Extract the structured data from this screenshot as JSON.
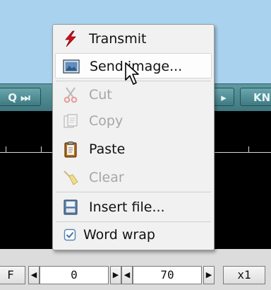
{
  "toolbar": {
    "left_button": "Q ⏭",
    "mid_button": "▸",
    "right_button": "KN"
  },
  "menu": {
    "items": [
      {
        "label": "Transmit",
        "icon": "lightning-icon",
        "enabled": true
      },
      {
        "label": "Send image...",
        "icon": "image-icon",
        "enabled": true,
        "highlighted": true
      },
      {
        "label": "Cut",
        "icon": "scissors-icon",
        "enabled": false
      },
      {
        "label": "Copy",
        "icon": "copy-icon",
        "enabled": false
      },
      {
        "label": "Paste",
        "icon": "clipboard-icon",
        "enabled": true
      },
      {
        "label": "Clear",
        "icon": "broom-icon",
        "enabled": false
      },
      {
        "label": "Insert file...",
        "icon": "file-icon",
        "enabled": true
      },
      {
        "label": "Word wrap",
        "icon": "checkbox-icon",
        "enabled": true,
        "checked": true
      }
    ]
  },
  "bottom_bar": {
    "f_label": "F",
    "left_value": "0",
    "right_value": "70",
    "zoom_label": "x1"
  },
  "colors": {
    "sky": "#a8d2ee",
    "toolbar_teal": "#4d8a91",
    "waterfall": "#000000",
    "menu_bg": "#f1f1f1",
    "lightning_red": "#d3101a"
  }
}
